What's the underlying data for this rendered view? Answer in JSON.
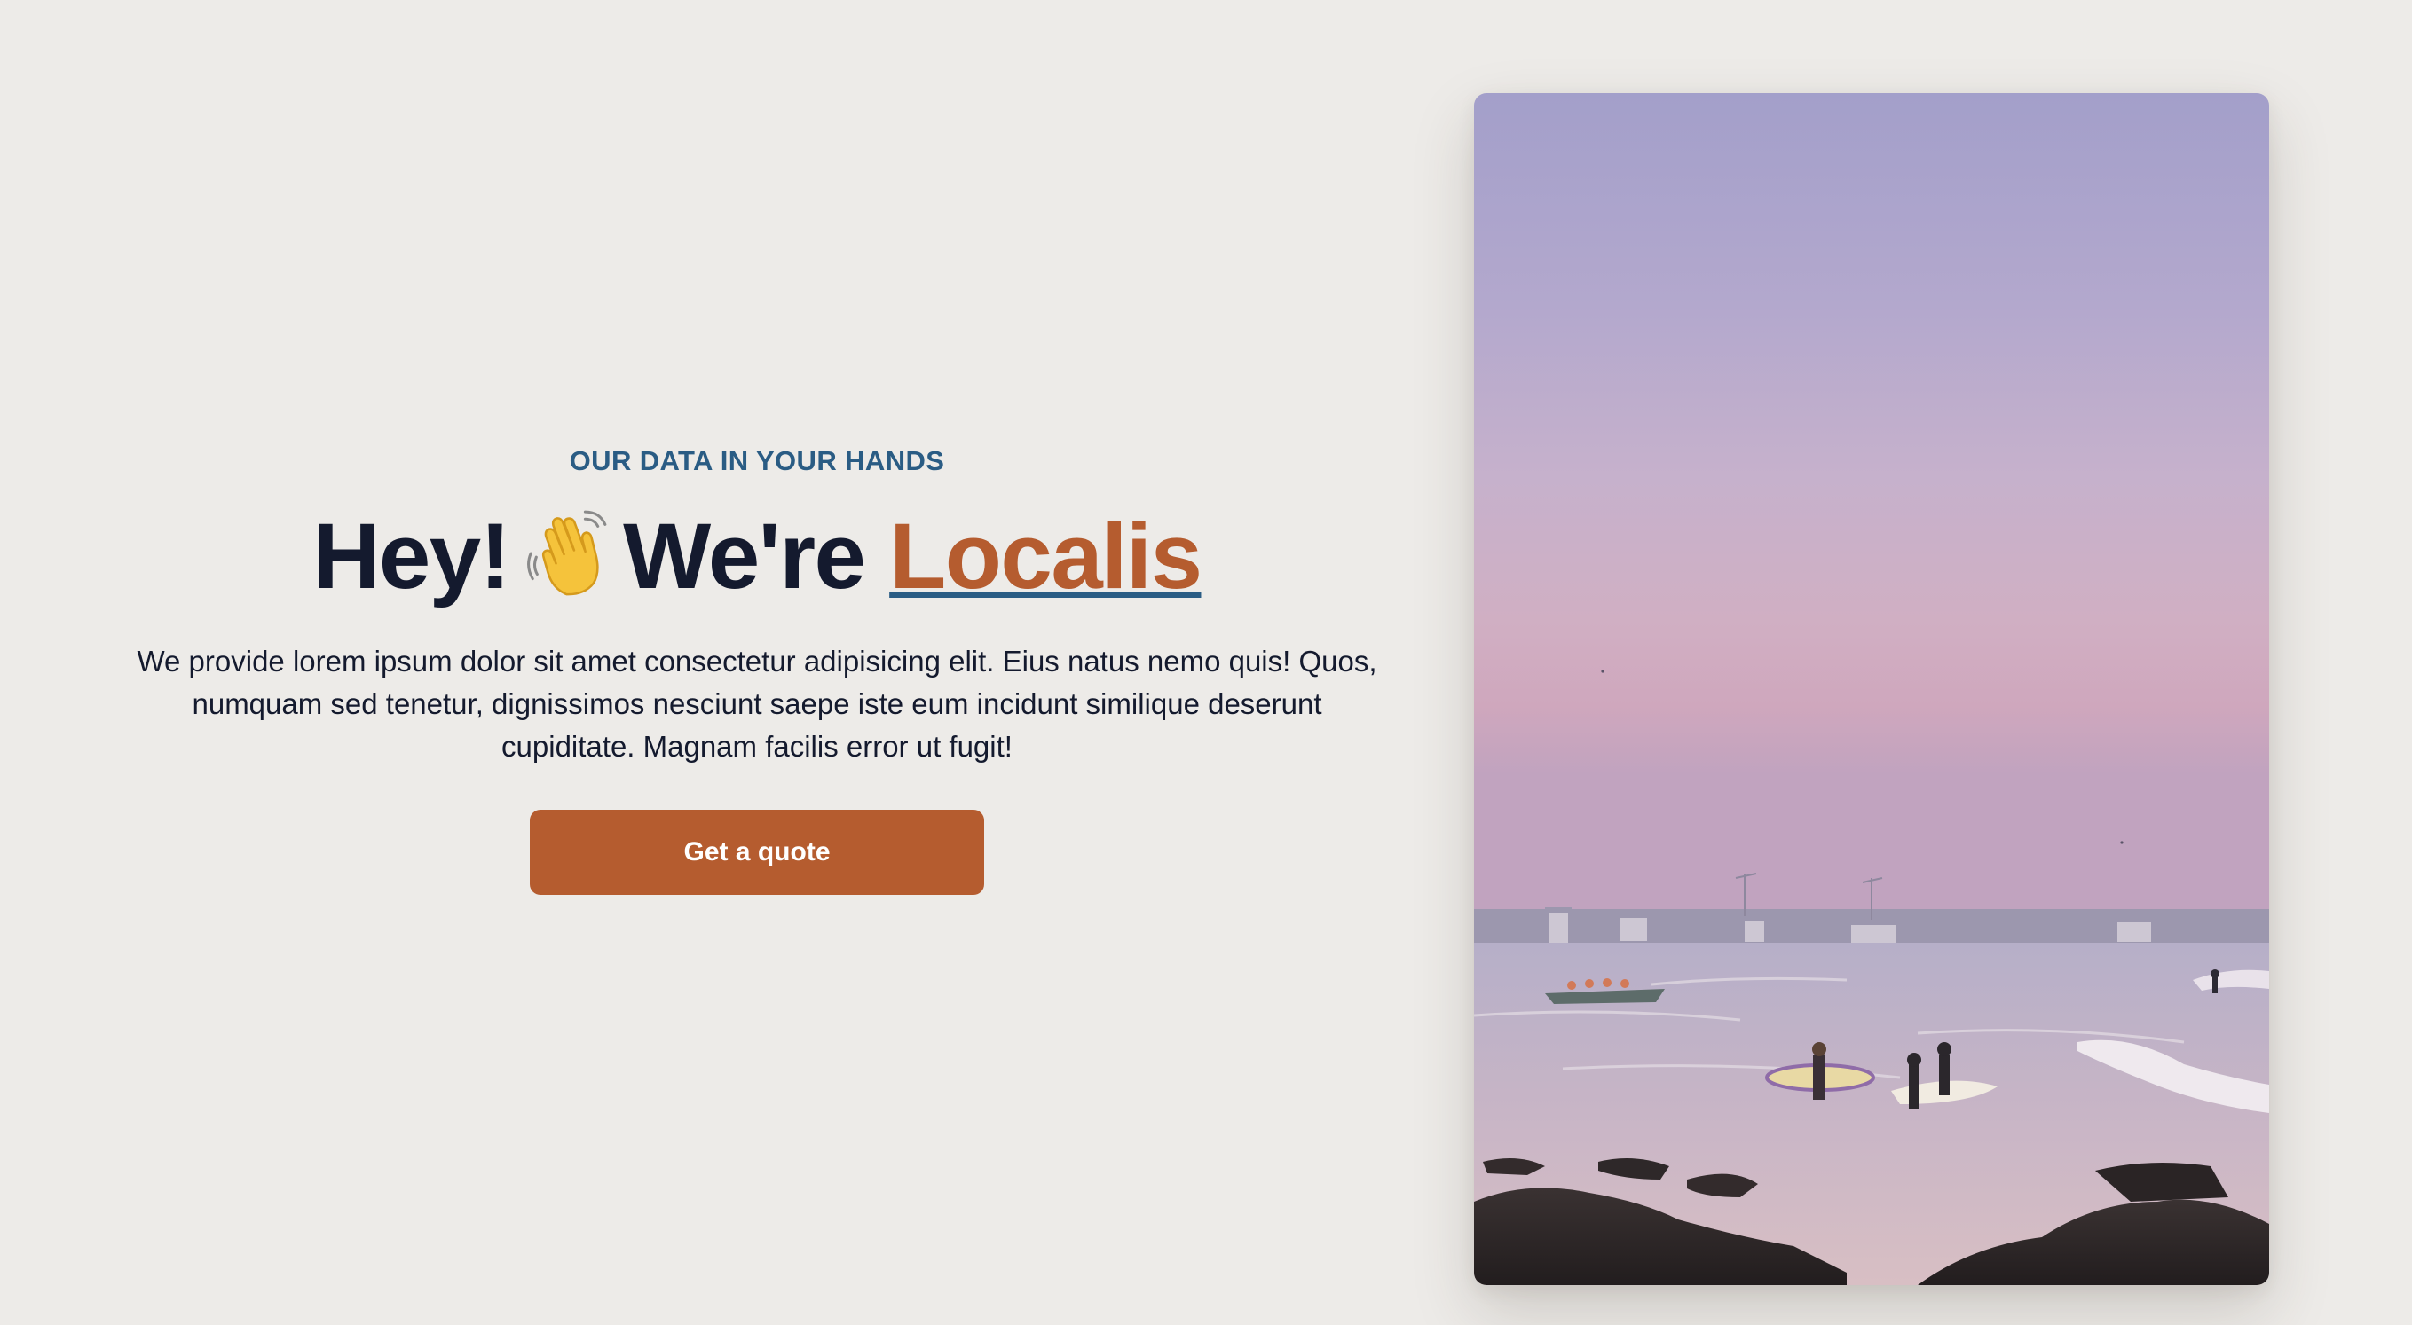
{
  "hero": {
    "eyebrow": "OUR DATA IN YOUR HANDS",
    "headline_prefix": "Hey!",
    "wave_emoji": "👋",
    "headline_middle": "We're",
    "brand_name": "Localis",
    "description": "We provide lorem ipsum dolor sit amet consectetur adipisicing elit. Eius natus nemo quis! Quos, numquam sed tenetur, dignissimos nesciunt saepe iste eum incidunt similique deserunt cupiditate. Magnam facilis error ut fugit!",
    "cta_label": "Get a quote"
  },
  "photo": {
    "subject": "beach-sunset-surfers"
  },
  "colors": {
    "background": "#edebe8",
    "eyebrow": "#2a5c84",
    "heading": "#141a2e",
    "accent": "#b55c2f",
    "underline": "#2a5c84"
  }
}
